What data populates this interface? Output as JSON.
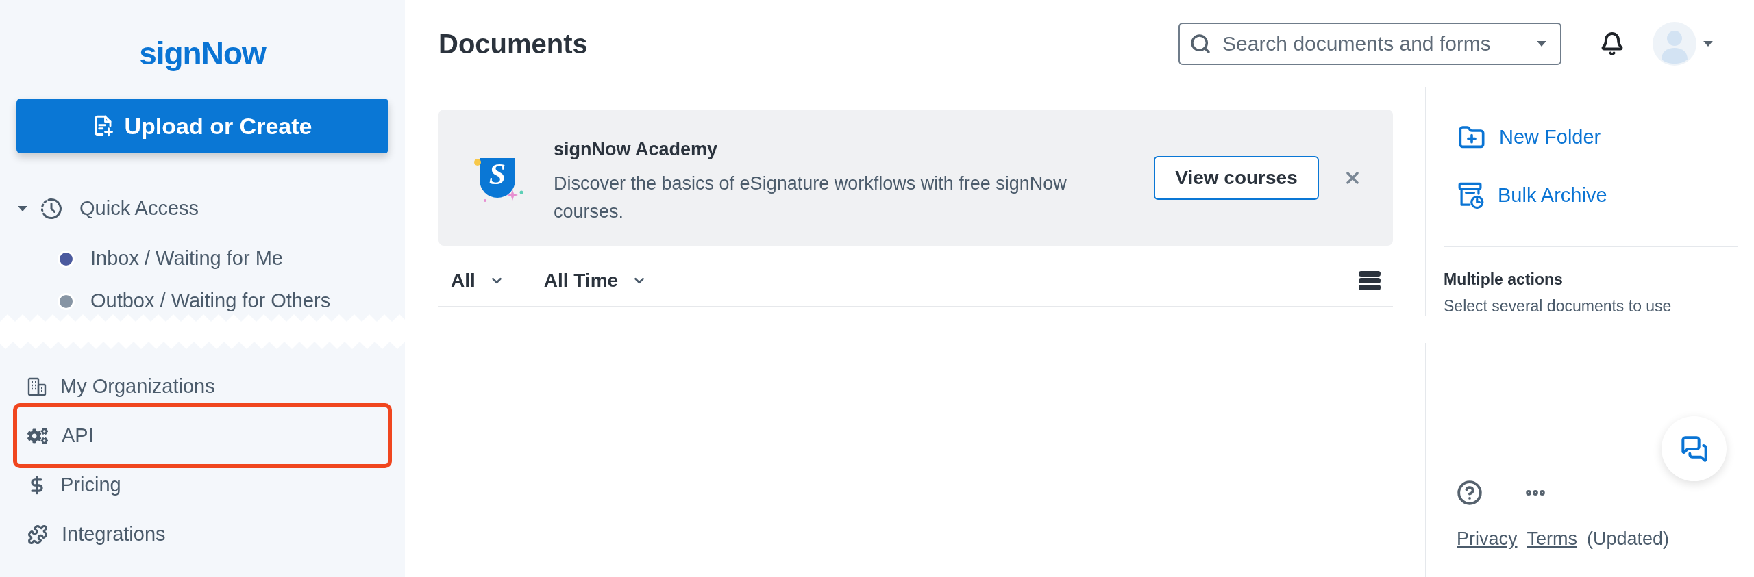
{
  "sidebar": {
    "logo": "signNow",
    "upload_button": {
      "label": "Upload or Create"
    },
    "quick_access": {
      "label": "Quick Access",
      "expanded": true,
      "items": [
        {
          "label": "Inbox / Waiting for Me",
          "color": "#4b5a9e"
        },
        {
          "label": "Outbox / Waiting for Others",
          "color": "#8795a4"
        }
      ]
    },
    "items": [
      {
        "kind": "organizations",
        "label": "My Organizations",
        "highlighted": false
      },
      {
        "kind": "api",
        "label": "API",
        "highlighted": true
      },
      {
        "kind": "pricing",
        "label": "Pricing",
        "highlighted": false
      },
      {
        "kind": "integrations",
        "label": "Integrations",
        "highlighted": false
      }
    ]
  },
  "header": {
    "title": "Documents",
    "search": {
      "placeholder": "Search documents and forms"
    }
  },
  "banner": {
    "logo_text": "S",
    "title": "signNow Academy",
    "description": "Discover the basics of eSignature workflows with free signNow courses.",
    "button": "View courses"
  },
  "filters": [
    {
      "label": "All"
    },
    {
      "label": "All Time"
    }
  ],
  "actions": [
    {
      "kind": "new_folder",
      "label": "New Folder"
    },
    {
      "kind": "bulk_archive",
      "label": "Bulk Archive"
    }
  ],
  "multiple_actions": {
    "title": "Multiple actions",
    "hint": "Select several documents to use"
  },
  "footer": {
    "links": [
      "Privacy",
      "Terms"
    ],
    "note": "(Updated)"
  }
}
